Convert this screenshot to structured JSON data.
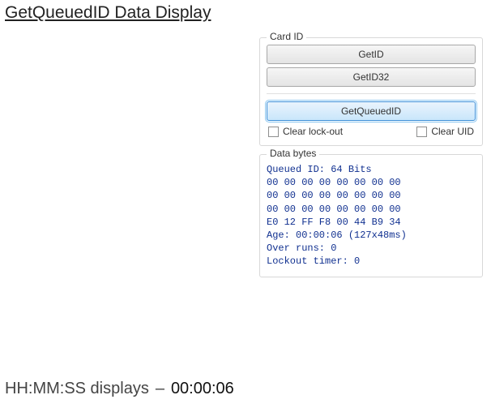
{
  "title": "GetQueuedID Data Display",
  "card_id": {
    "legend": "Card ID",
    "buttons": {
      "get_id": "GetID",
      "get_id32": "GetID32",
      "get_queued_id": "GetQueuedID"
    },
    "checkboxes": {
      "clear_lockout": "Clear lock-out",
      "clear_uid": "Clear UID"
    }
  },
  "data_bytes": {
    "legend": "Data bytes",
    "lines": [
      "Queued ID: 64 Bits",
      "00 00 00 00 00 00 00 00",
      "00 00 00 00 00 00 00 00",
      "00 00 00 00 00 00 00 00",
      "E0 12 FF F8 00 44 B9 34",
      "Age: 00:00:06 (127x48ms)",
      "Over runs: 0",
      "Lockout timer: 0"
    ]
  },
  "footer": {
    "label": "HH:MM:SS displays",
    "dash": "–",
    "time": "00:00:06"
  }
}
